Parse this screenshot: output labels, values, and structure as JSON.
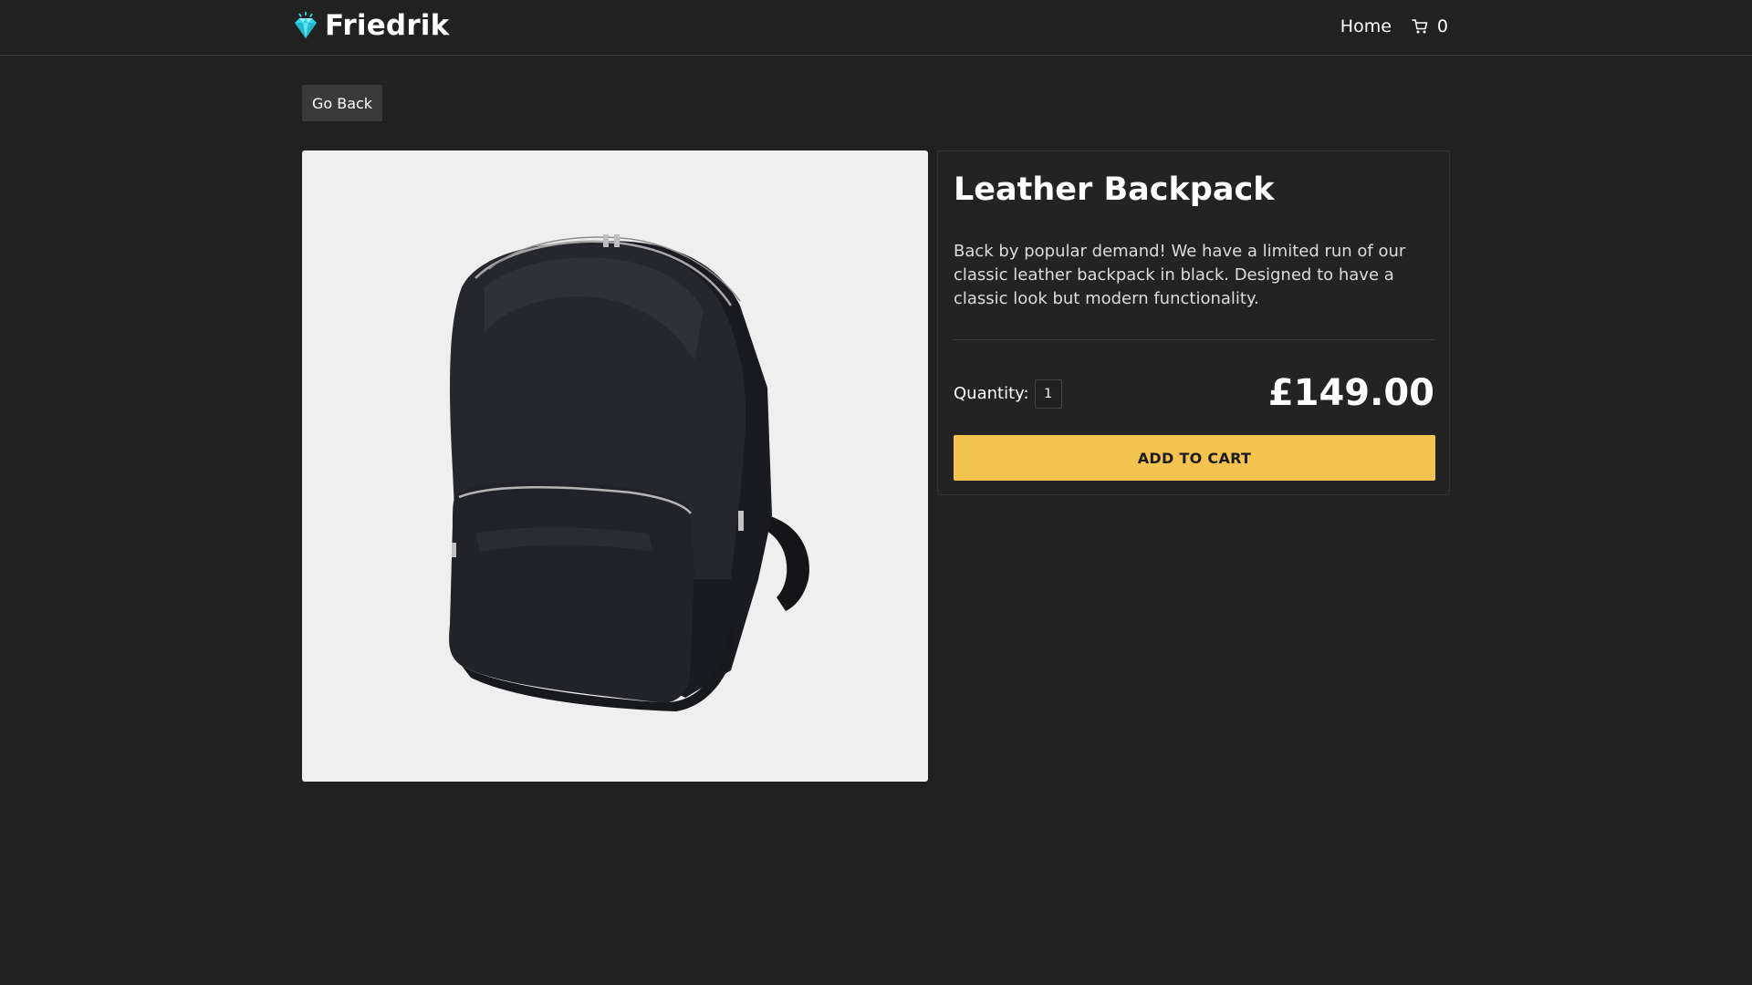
{
  "navbar": {
    "brand_name": "Friedrik",
    "brand_icon": "gem-icon",
    "home_label": "Home",
    "cart_icon": "cart-icon",
    "cart_count": "0"
  },
  "actions": {
    "go_back_label": "Go Back"
  },
  "product": {
    "title": "Leather Backpack",
    "description": "Back by popular demand! We have a limited run of our classic leather backpack in black. Designed to have a classic look but modern functionality.",
    "quantity_label": "Quantity:",
    "quantity_value": "1",
    "price": "£149.00",
    "add_to_cart_label": "ADD TO CART"
  },
  "colors": {
    "background": "#212121",
    "accent": "#f5c350",
    "brand_gem": "#2fd6e8"
  }
}
